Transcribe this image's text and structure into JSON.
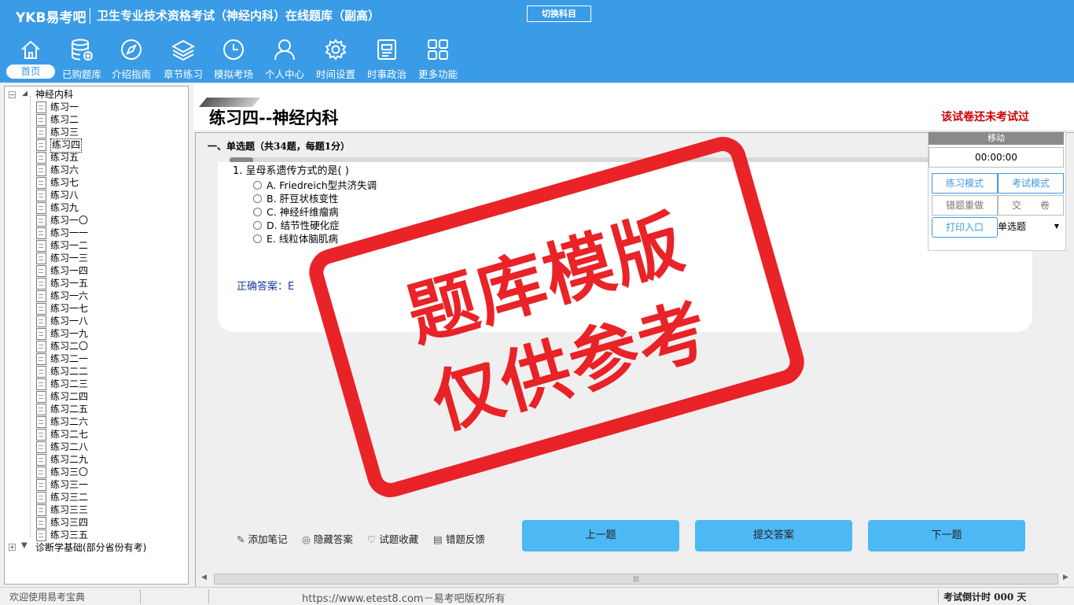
{
  "header": {
    "logo": "YKB易考吧",
    "title": "卫生专业技术资格考试（神经内科）在线题库（副高）",
    "switch_label": "切换科目"
  },
  "nav": [
    {
      "label": "首页",
      "icon": "home-icon",
      "active": true
    },
    {
      "label": "已购题库",
      "icon": "database-icon"
    },
    {
      "label": "介绍指南",
      "icon": "compass-icon"
    },
    {
      "label": "章节练习",
      "icon": "layers-icon"
    },
    {
      "label": "模拟考场",
      "icon": "clock-icon"
    },
    {
      "label": "个人中心",
      "icon": "user-icon"
    },
    {
      "label": "时间设置",
      "icon": "gear-icon"
    },
    {
      "label": "时事政治",
      "icon": "news-icon"
    },
    {
      "label": "更多功能",
      "icon": "grid-icon"
    }
  ],
  "tree": {
    "root": "神经内科",
    "items": [
      "练习一",
      "练习二",
      "练习三",
      "练习四",
      "练习五",
      "练习六",
      "练习七",
      "练习八",
      "练习九",
      "练习一〇",
      "练习一一",
      "练习一二",
      "练习一三",
      "练习一四",
      "练习一五",
      "练习一六",
      "练习一七",
      "练习一八",
      "练习一九",
      "练习二〇",
      "练习二一",
      "练习二二",
      "练习二三",
      "练习二四",
      "练习二五",
      "练习二六",
      "练习二七",
      "练习二八",
      "练习二九",
      "练习三〇",
      "练习三一",
      "练习三二",
      "练习三三",
      "练习三四",
      "练习三五"
    ],
    "selected_index": 3,
    "collapsed_node": "诊断学基础(部分省份有考)"
  },
  "paper": {
    "title": "练习四--神经内科",
    "status": "该试卷还未考试过",
    "section": "一、单选题（共34题，每题1分）",
    "progress": 0.03
  },
  "question": {
    "text": "1. 呈母系遗传方式的是( )",
    "options": [
      "A. Friedreich型共济失调",
      "B. 肝豆状核变性",
      "C. 神经纤维瘤病",
      "D. 结节性硬化症",
      "E. 线粒体脑肌病"
    ],
    "answer": "正确答案：E"
  },
  "panel": {
    "move": "移动",
    "timer": "00:00:00",
    "practice_mode": "练习模式",
    "exam_mode": "考试模式",
    "redo_wrong": "错题重做",
    "submit_paper": "交　　卷",
    "print": "打印入口",
    "type_select": "单选题"
  },
  "tools": [
    "添加笔记",
    "隐藏答案",
    "试题收藏",
    "错题反馈"
  ],
  "buttons": {
    "prev": "上一题",
    "submit": "提交答案",
    "next": "下一题"
  },
  "stamp": {
    "line1": "题库模版",
    "line2": "仅供参考"
  },
  "status": {
    "welcome": "欢迎使用易考宝典",
    "copyright": "https://www.etest8.com－易考吧版权所有",
    "countdown": "考试倒计时 000 天"
  },
  "colors": {
    "header": "#3a9be6",
    "button": "#4cb9f5",
    "stamp": "#e8181c",
    "status_red": "#cc0000"
  }
}
